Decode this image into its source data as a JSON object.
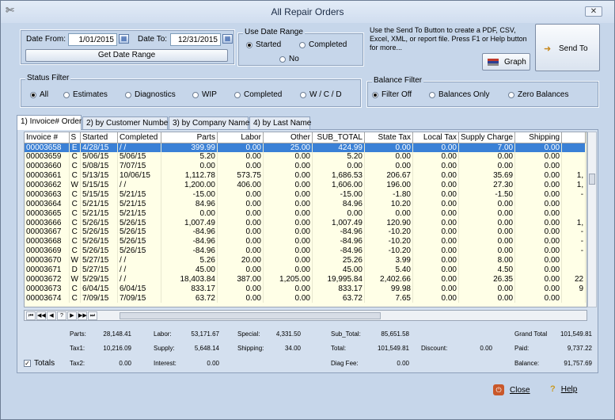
{
  "window": {
    "title": "All Repair Orders",
    "close": "✕"
  },
  "date": {
    "from_label": "Date From:",
    "from_value": "1/01/2015",
    "to_label": "Date To:",
    "to_value": "12/31/2015",
    "get_button": "Get Date Range"
  },
  "use_date_range": {
    "title": "Use Date Range",
    "options": [
      "Started",
      "Completed",
      "No"
    ]
  },
  "info_text": "Use the Send To Button to create a PDF, CSV, Excel, XML, or report file. Press F1 or Help button for more...",
  "buttons": {
    "send_to": "Send To",
    "graph": "Graph",
    "close": "Close",
    "help": "Help"
  },
  "status_filter": {
    "title": "Status Filter",
    "options": [
      "All",
      "Estimates",
      "Diagnostics",
      "WIP",
      "Completed",
      "W / C / D"
    ]
  },
  "balance_filter": {
    "title": "Balance Filter",
    "options": [
      "Filter Off",
      "Balances Only",
      "Zero Balances"
    ]
  },
  "tabs": [
    "1) Invoice# Order",
    "2) by Customer Number",
    "3) by Company Name",
    "4) by Last Name"
  ],
  "table": {
    "columns": [
      "Invoice #",
      "S",
      "Started",
      "Completed",
      "Parts",
      "Labor",
      "Other",
      "SUB_TOTAL",
      "State Tax",
      "Local Tax",
      "Supply Charge",
      "Shipping",
      ""
    ],
    "rows": [
      [
        "00003658",
        "E",
        "4/28/15",
        "  /  /",
        "399.99",
        "0.00",
        "25.00",
        "424.99",
        "0.00",
        "0.00",
        "7.00",
        "0.00",
        ""
      ],
      [
        "00003659",
        "C",
        "5/06/15",
        "5/06/15",
        "5.20",
        "0.00",
        "0.00",
        "5.20",
        "0.00",
        "0.00",
        "0.00",
        "0.00",
        ""
      ],
      [
        "00003660",
        "C",
        "5/08/15",
        "7/07/15",
        "0.00",
        "0.00",
        "0.00",
        "0.00",
        "0.00",
        "0.00",
        "0.00",
        "0.00",
        ""
      ],
      [
        "00003661",
        "C",
        "5/13/15",
        "10/06/15",
        "1,112.78",
        "573.75",
        "0.00",
        "1,686.53",
        "206.67",
        "0.00",
        "35.69",
        "0.00",
        "1,"
      ],
      [
        "00003662",
        "W",
        "5/15/15",
        "  /  /",
        "1,200.00",
        "406.00",
        "0.00",
        "1,606.00",
        "196.00",
        "0.00",
        "27.30",
        "0.00",
        "1,"
      ],
      [
        "00003663",
        "C",
        "5/15/15",
        "5/21/15",
        "-15.00",
        "0.00",
        "0.00",
        "-15.00",
        "-1.80",
        "0.00",
        "-1.50",
        "0.00",
        "-"
      ],
      [
        "00003664",
        "C",
        "5/21/15",
        "5/21/15",
        "84.96",
        "0.00",
        "0.00",
        "84.96",
        "10.20",
        "0.00",
        "0.00",
        "0.00",
        ""
      ],
      [
        "00003665",
        "C",
        "5/21/15",
        "5/21/15",
        "0.00",
        "0.00",
        "0.00",
        "0.00",
        "0.00",
        "0.00",
        "0.00",
        "0.00",
        ""
      ],
      [
        "00003666",
        "C",
        "5/26/15",
        "5/26/15",
        "1,007.49",
        "0.00",
        "0.00",
        "1,007.49",
        "120.90",
        "0.00",
        "0.00",
        "0.00",
        "1,"
      ],
      [
        "00003667",
        "C",
        "5/26/15",
        "5/26/15",
        "-84.96",
        "0.00",
        "0.00",
        "-84.96",
        "-10.20",
        "0.00",
        "0.00",
        "0.00",
        "-"
      ],
      [
        "00003668",
        "C",
        "5/26/15",
        "5/26/15",
        "-84.96",
        "0.00",
        "0.00",
        "-84.96",
        "-10.20",
        "0.00",
        "0.00",
        "0.00",
        "-"
      ],
      [
        "00003669",
        "C",
        "5/26/15",
        "5/26/15",
        "-84.96",
        "0.00",
        "0.00",
        "-84.96",
        "-10.20",
        "0.00",
        "0.00",
        "0.00",
        "-"
      ],
      [
        "00003670",
        "W",
        "5/27/15",
        "  /  /",
        "5.26",
        "20.00",
        "0.00",
        "25.26",
        "3.99",
        "0.00",
        "8.00",
        "0.00",
        ""
      ],
      [
        "00003671",
        "D",
        "5/27/15",
        "  /  /",
        "45.00",
        "0.00",
        "0.00",
        "45.00",
        "5.40",
        "0.00",
        "4.50",
        "0.00",
        ""
      ],
      [
        "00003672",
        "W",
        "5/29/15",
        "  /  /",
        "18,403.84",
        "387.00",
        "1,205.00",
        "19,995.84",
        "2,402.66",
        "0.00",
        "26.35",
        "0.00",
        "22"
      ],
      [
        "00003673",
        "C",
        "6/04/15",
        "6/04/15",
        "833.17",
        "0.00",
        "0.00",
        "833.17",
        "99.98",
        "0.00",
        "0.00",
        "0.00",
        "9"
      ],
      [
        "00003674",
        "C",
        "7/09/15",
        "7/09/15",
        "63.72",
        "0.00",
        "0.00",
        "63.72",
        "7.65",
        "0.00",
        "0.00",
        "0.00",
        ""
      ]
    ]
  },
  "nav": [
    "⏮",
    "◀◀",
    "◀",
    "?",
    "▶",
    "▶▶",
    "⏭"
  ],
  "totals": {
    "parts_l": "Parts:",
    "parts": "28,148.41",
    "tax1_l": "Tax1:",
    "tax1": "10,216.09",
    "tax2_l": "Tax2:",
    "tax2": "0.00",
    "labor_l": "Labor:",
    "labor": "53,171.67",
    "supply_l": "Supply:",
    "supply": "5,648.14",
    "interest_l": "Interest:",
    "interest": "0.00",
    "special_l": "Special:",
    "special": "4,331.50",
    "shipping_l": "Shipping:",
    "shipping": "34.00",
    "subtotal_l": "Sub_Total:",
    "subtotal": "85,651.58",
    "total_l": "Total:",
    "total": "101,549.81",
    "diag_l": "Diag Fee:",
    "diag": "0.00",
    "discount_l": "Discount:",
    "discount": "0.00",
    "grand_l": "Grand Total",
    "grand": "101,549.81",
    "paid_l": "Paid:",
    "paid": "9,737.22",
    "balance_l": "Balance:",
    "balance": "91,757.69",
    "totals_check": "Totals"
  }
}
